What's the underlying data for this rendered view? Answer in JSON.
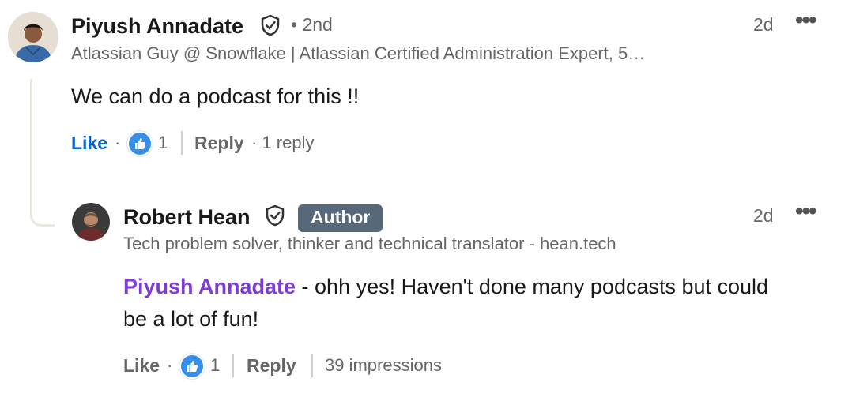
{
  "comments": [
    {
      "author": "Piyush Annadate",
      "degree": "• 2nd",
      "headline": "Atlassian Guy @ Snowflake | Atlassian Certified Administration Expert, 5…",
      "time": "2d",
      "text": "We can do a podcast for this !!",
      "like_label": "Like",
      "reaction_count": "1",
      "reply_label": "Reply",
      "reply_count": "· 1 reply",
      "dot": "·"
    },
    {
      "author": "Robert Hean",
      "badge": "Author",
      "headline": "Tech problem solver, thinker and technical translator - hean.tech",
      "time": "2d",
      "mention": "Piyush Annadate",
      "text_line1": " - ohh yes! Haven't done many podcasts but could",
      "text_line2": "be a lot of fun!",
      "like_label": "Like",
      "reaction_count": "1",
      "reply_label": "Reply",
      "impressions": "39 impressions",
      "dot": "·"
    }
  ],
  "colors": {
    "like_active": "#0a66c2",
    "mention": "#7d3cd6",
    "badge_bg": "#56687a",
    "reaction_bg": "#378fe9"
  },
  "icons": [
    "verified-shield-icon",
    "more-options-icon",
    "like-reaction-icon",
    "avatar"
  ]
}
